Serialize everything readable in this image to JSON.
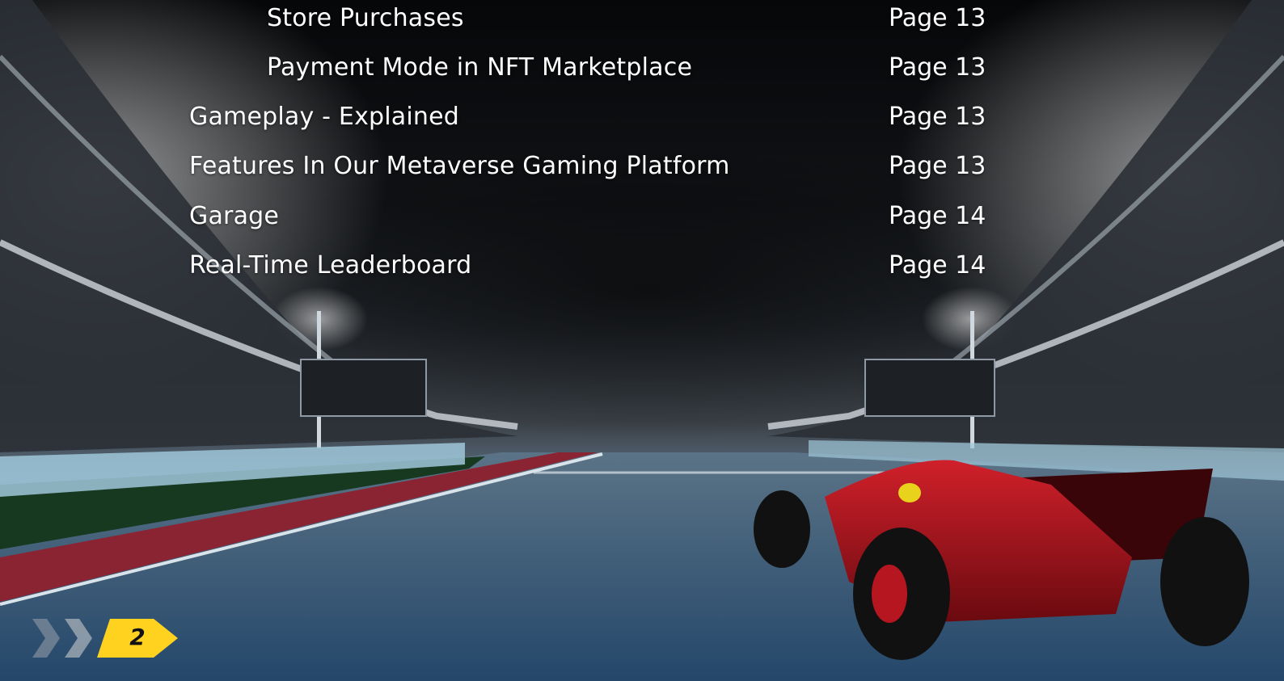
{
  "toc": {
    "entries": [
      {
        "title": "Store Purchases",
        "page": "Page 13",
        "level": 2
      },
      {
        "title": "Payment Mode in NFT Marketplace",
        "page": "Page 13",
        "level": 2
      },
      {
        "title": "Gameplay - Explained",
        "page": "Page 13",
        "level": 1
      },
      {
        "title": "Features In Our Metaverse Gaming Platform",
        "page": "Page 13",
        "level": 1
      },
      {
        "title": "Garage",
        "page": "Page 14",
        "level": 1
      },
      {
        "title": "Real-Time Leaderboard",
        "page": "Page 14",
        "level": 1
      }
    ]
  },
  "footer": {
    "page_number": "2",
    "badge_color": "#FFD21F"
  }
}
